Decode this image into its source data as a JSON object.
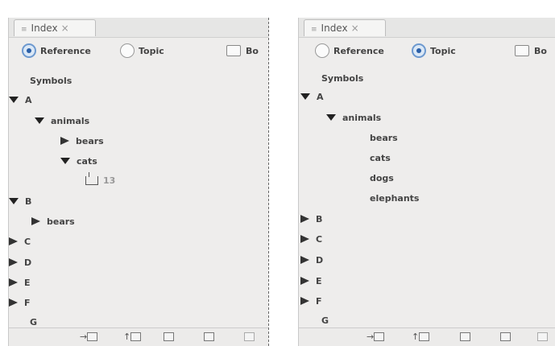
{
  "panels": [
    {
      "tab": {
        "grip": "≡",
        "label": "Index",
        "close": "×"
      },
      "radio_reference": {
        "label": "Reference",
        "selected": true
      },
      "radio_topic": {
        "label": "Topic",
        "selected": false
      },
      "book_checkbox": {
        "label": "Bo"
      },
      "tree": {
        "symbols": "Symbols",
        "A": "A",
        "animals": "animals",
        "bears": "bears",
        "cats": "cats",
        "page_ref": "13",
        "B": "B",
        "b_bears": "bears",
        "C": "C",
        "D": "D",
        "E": "E",
        "F": "F",
        "G": "G"
      }
    },
    {
      "tab": {
        "grip": "≡",
        "label": "Index",
        "close": "×"
      },
      "radio_reference": {
        "label": "Reference",
        "selected": false
      },
      "radio_topic": {
        "label": "Topic",
        "selected": true
      },
      "book_checkbox": {
        "label": "Bo"
      },
      "tree": {
        "symbols": "Symbols",
        "A": "A",
        "animals": "animals",
        "bears": "bears",
        "cats": "cats",
        "dogs": "dogs",
        "elephants": "elephants",
        "B": "B",
        "C": "C",
        "D": "D",
        "E": "E",
        "F": "F",
        "G": "G"
      }
    }
  ],
  "icons": {
    "goto": "go-to-entry-icon",
    "update": "update-preview-icon",
    "generate": "generate-index-icon",
    "new": "new-entry-icon",
    "delete": "delete-icon"
  }
}
